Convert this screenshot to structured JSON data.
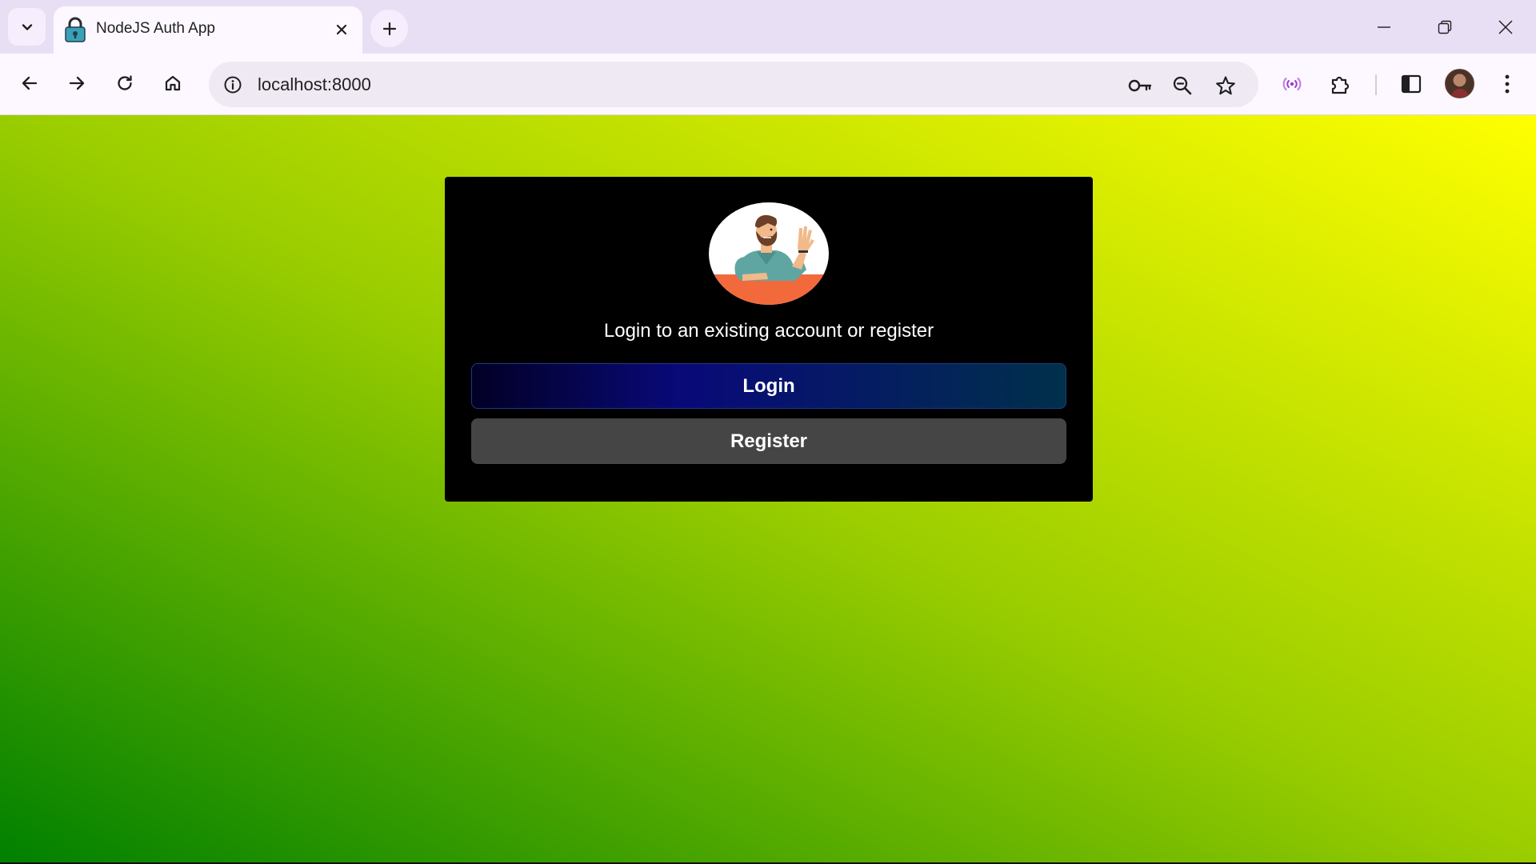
{
  "browser": {
    "tab": {
      "title": "NodeJS Auth App",
      "favicon": "padlock-icon"
    },
    "address_bar": {
      "url": "localhost:8000"
    },
    "icons": {
      "tab_search": "chevron-down-icon",
      "tab_close": "close-icon",
      "new_tab": "plus-icon",
      "minimize": "minimize-icon",
      "restore": "restore-icon",
      "close_window": "close-icon",
      "back": "arrow-left-icon",
      "forward": "arrow-right-icon",
      "reload": "reload-icon",
      "home": "home-icon",
      "site_info": "info-icon",
      "passwords": "key-icon",
      "zoom": "zoom-out-icon",
      "bookmark": "star-icon",
      "media": "broadcast-icon",
      "extensions": "puzzle-icon",
      "side_panel": "side-panel-icon",
      "profile": "avatar",
      "menu": "kebab-menu-icon"
    }
  },
  "page": {
    "background_colors": [
      "#008000",
      "#9acd00",
      "#ffff00"
    ],
    "card": {
      "image": "waving-man-illustration",
      "message": "Login to an existing account or register",
      "login_label": "Login",
      "register_label": "Register",
      "login_colors": [
        "#020024",
        "#090979",
        "#00304a"
      ],
      "register_color": "#454545"
    }
  }
}
